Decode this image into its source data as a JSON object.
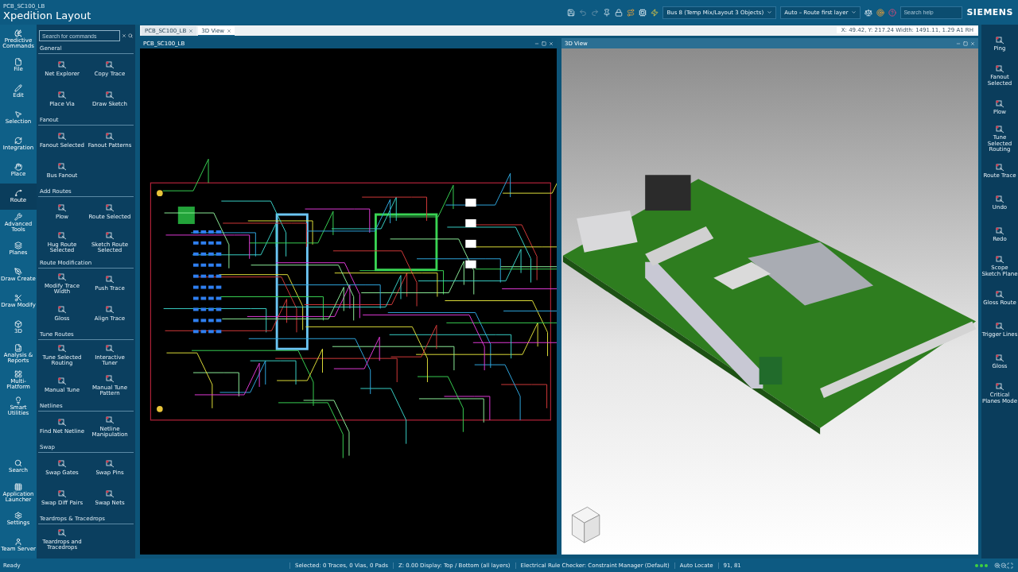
{
  "window": {
    "file_name": "PCB_SC100_LB",
    "title": "Xpedition Layout",
    "brand": "SIEMENS"
  },
  "toolbar": {
    "dropdowns": [
      "Bus 8 (Temp Mix/Layout 3 Objects)",
      "Auto – Route first layer"
    ],
    "search": {
      "placeholder": "Search help"
    }
  },
  "coordinates": "X: 49.42, Y: 217.24 Width: 1491.11, 1.29 A1 RH",
  "left_rail": {
    "items": [
      {
        "label": "Predictive Commands",
        "selected": false
      },
      {
        "label": "File",
        "selected": false
      },
      {
        "label": "Edit",
        "selected": false
      },
      {
        "label": "Selection",
        "selected": false
      },
      {
        "label": "Integration",
        "selected": false
      },
      {
        "label": "Place",
        "selected": false
      },
      {
        "label": "Route",
        "selected": true
      },
      {
        "label": "Advanced Tools",
        "selected": false
      },
      {
        "label": "Planes",
        "selected": false
      },
      {
        "label": "Draw Create",
        "selected": false
      },
      {
        "label": "Draw Modify",
        "selected": false
      },
      {
        "label": "3D",
        "selected": false
      },
      {
        "label": "Analysis & Reports",
        "selected": false
      },
      {
        "label": "Multi-Platform",
        "selected": false
      },
      {
        "label": "Smart Utilities",
        "selected": false
      }
    ],
    "bottom_items": [
      {
        "label": "Search",
        "selected": false
      },
      {
        "label": "Application Launcher",
        "selected": false
      },
      {
        "label": "Settings",
        "selected": false
      },
      {
        "label": "Team Server",
        "selected": false
      }
    ]
  },
  "commands": {
    "search": {
      "placeholder": "Search for commands"
    },
    "sections": [
      {
        "title": "General",
        "items": [
          "Net Explorer",
          "Copy Trace",
          "Place Via",
          "Draw Sketch"
        ]
      },
      {
        "title": "Fanout",
        "items": [
          "Fanout Selected",
          "Fanout Patterns",
          "Bus Fanout"
        ]
      },
      {
        "title": "Add Routes",
        "items": [
          "Plow",
          "Route Selected",
          "Hug Route Selected",
          "Sketch Route Selected"
        ]
      },
      {
        "title": "Route Modification",
        "items": [
          "Modify Trace Width",
          "Push Trace",
          "Gloss",
          "Align Trace"
        ]
      },
      {
        "title": "Tune Routes",
        "items": [
          "Tune Selected Routing",
          "Interactive Tuner",
          "Manual Tune",
          "Manual Tune Pattern"
        ]
      },
      {
        "title": "Netlines",
        "items": [
          "Find Net Netline",
          "Netline Manipulation"
        ]
      },
      {
        "title": "Swap",
        "items": [
          "Swap Gates",
          "Swap Pins",
          "Swap Diff Pairs",
          "Swap Nets"
        ]
      },
      {
        "title": "Teardrops & Tracedrops",
        "items": [
          "Teardrops and Tracedrops"
        ]
      }
    ]
  },
  "document_tabs": [
    {
      "label": "PCB_SC100_LB",
      "selected": false
    },
    {
      "label": "3D View",
      "selected": true
    }
  ],
  "panels": [
    {
      "title": "PCB_SC100_LB",
      "kind": "pcb"
    },
    {
      "title": "3D View",
      "kind": "model"
    }
  ],
  "right_rail": {
    "items": [
      "Ping",
      "Fanout Selected",
      "Plow",
      "Tune Selected Routing",
      "Route Trace",
      "Undo",
      "Redo",
      "Scope Sketch Plane",
      "Gloss Route",
      "Trigger Lines",
      "Gloss",
      "Critical Planes Mode"
    ]
  },
  "status_bar": {
    "message": "Ready",
    "segments": [
      "Selected: 0 Traces, 0 Vias, 0 Pads",
      "Z: 0.00 Display: Top / Bottom (all layers)",
      "Electrical Rule Checker: Constraint Manager (Default)",
      "Auto Locate",
      "91, 81"
    ]
  }
}
